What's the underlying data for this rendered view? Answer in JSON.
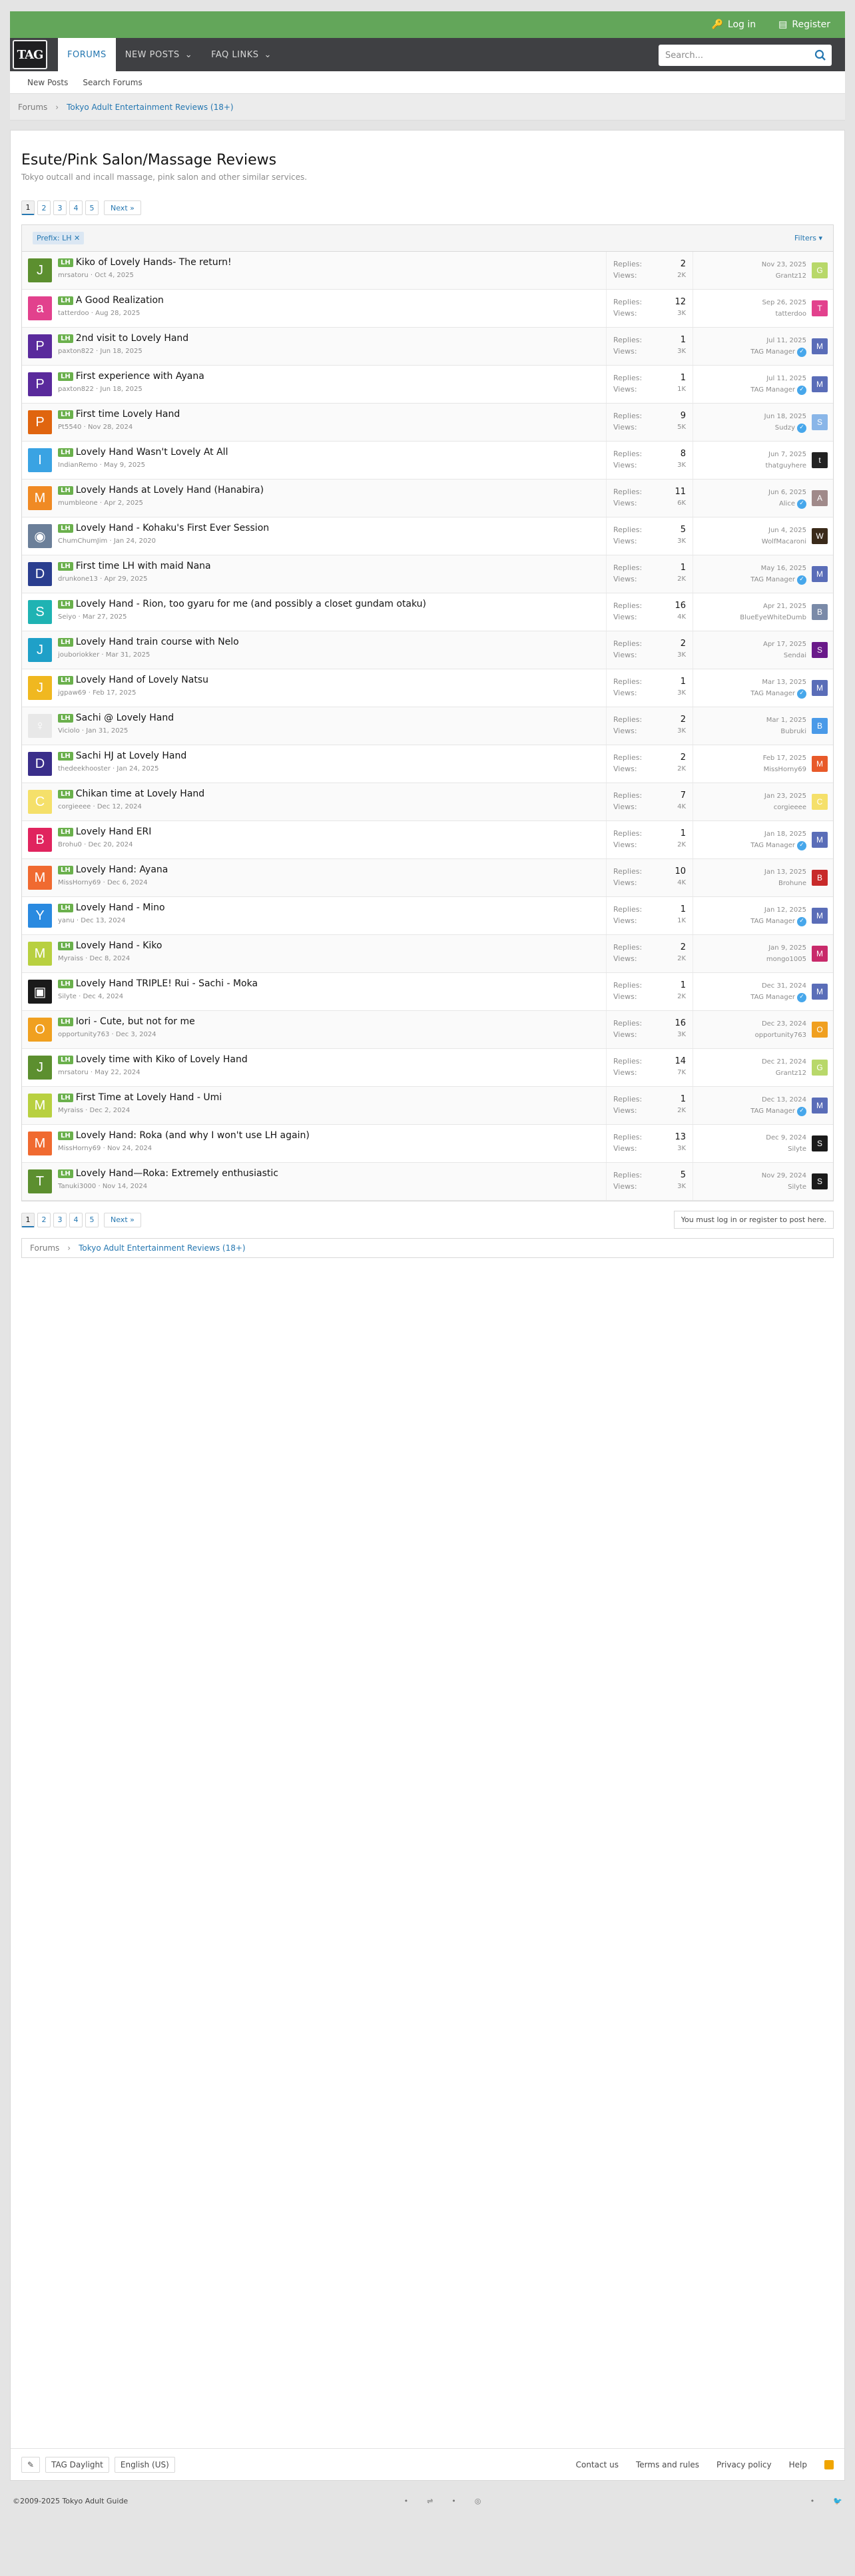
{
  "topbar": {
    "login": "Log in",
    "register": "Register"
  },
  "nav": {
    "logo": "TAG",
    "tabs": [
      {
        "label": "FORUMS"
      },
      {
        "label": "NEW POSTS"
      },
      {
        "label": "FAQ LINKS"
      }
    ],
    "search_placeholder": "Search..."
  },
  "subnav": {
    "items": [
      "New Posts",
      "Search Forums"
    ]
  },
  "breadcrumb": {
    "root": "Forums",
    "current": "Tokyo Adult Entertainment Reviews (18+)"
  },
  "page": {
    "title": "Esute/Pink Salon/Massage Reviews",
    "description": "Tokyo outcall and incall massage, pink salon and other similar services."
  },
  "pager": {
    "pages": [
      "1",
      "2",
      "3",
      "4",
      "5"
    ],
    "next": "Next »"
  },
  "filter": {
    "chip": "Prefix: LH ✕",
    "filters": "Filters ▾"
  },
  "labels": {
    "replies": "Replies:",
    "views": "Views:"
  },
  "threads": [
    {
      "letter": "J",
      "color": "#5c8f2f",
      "prefix": "LH",
      "title": "Kiko of Lovely Hands- The return!",
      "author": "mrsatoru",
      "date": "Oct 4, 2025",
      "replies": "2",
      "views": "2K",
      "last_date": "Nov 23, 2025",
      "last_user": "Grantz12",
      "last_letter": "G",
      "last_color": "#b8d86a",
      "verified": false
    },
    {
      "letter": "a",
      "color": "#e2418d",
      "prefix": "LH",
      "title": "A Good Realization",
      "author": "tatterdoo",
      "date": "Aug 28, 2025",
      "replies": "12",
      "views": "3K",
      "last_date": "Sep 26, 2025",
      "last_user": "tatterdoo",
      "last_letter": "T",
      "last_color": "#e2418d",
      "verified": false
    },
    {
      "letter": "P",
      "color": "#5a2a9c",
      "prefix": "LH",
      "title": "2nd visit to Lovely Hand",
      "author": "paxton822",
      "date": "Jun 18, 2025",
      "replies": "1",
      "views": "3K",
      "last_date": "Jul 11, 2025",
      "last_user": "TAG Manager",
      "last_letter": "M",
      "last_color": "#5a6db8",
      "verified": true
    },
    {
      "letter": "P",
      "color": "#5a2a9c",
      "prefix": "LH",
      "title": "First experience with Ayana",
      "author": "paxton822",
      "date": "Jun 18, 2025",
      "replies": "1",
      "views": "1K",
      "last_date": "Jul 11, 2025",
      "last_user": "TAG Manager",
      "last_letter": "M",
      "last_color": "#5a6db8",
      "verified": true
    },
    {
      "letter": "P",
      "color": "#e0650f",
      "prefix": "LH",
      "title": "First time Lovely Hand",
      "author": "Pt5540",
      "date": "Nov 28, 2024",
      "replies": "9",
      "views": "5K",
      "last_date": "Jun 18, 2025",
      "last_user": "Sudzy",
      "last_letter": "S",
      "last_color": "#8ab6e8",
      "verified": true
    },
    {
      "letter": "I",
      "color": "#3aa3e3",
      "prefix": "LH",
      "title": "Lovely Hand Wasn't Lovely At All",
      "author": "IndianRemo",
      "date": "May 9, 2025",
      "replies": "8",
      "views": "3K",
      "last_date": "Jun 7, 2025",
      "last_user": "thatguyhere",
      "last_letter": "t",
      "last_color": "#222222",
      "verified": false
    },
    {
      "letter": "M",
      "color": "#f08a24",
      "prefix": "LH",
      "title": "Lovely Hands at Lovely Hand (Hanabira)",
      "author": "mumbleone",
      "date": "Apr 2, 2025",
      "replies": "11",
      "views": "6K",
      "last_date": "Jun 6, 2025",
      "last_user": "Alice",
      "last_letter": "A",
      "last_color": "#a08a8a",
      "verified": true
    },
    {
      "letter": "◉",
      "color": "#6b7f99",
      "prefix": "LH",
      "title": "Lovely Hand - Kohaku's First Ever Session",
      "author": "ChumChumJim",
      "date": "Jan 24, 2020",
      "replies": "5",
      "views": "3K",
      "last_date": "Jun 4, 2025",
      "last_user": "WolfMacaroni",
      "last_letter": "W",
      "last_color": "#3a2a1a",
      "verified": false
    },
    {
      "letter": "D",
      "color": "#2a3e8f",
      "prefix": "LH",
      "title": "First time LH with maid Nana",
      "author": "drunkone13",
      "date": "Apr 29, 2025",
      "replies": "1",
      "views": "2K",
      "last_date": "May 16, 2025",
      "last_user": "TAG Manager",
      "last_letter": "M",
      "last_color": "#5a6db8",
      "verified": true
    },
    {
      "letter": "S",
      "color": "#1fb3b3",
      "prefix": "LH",
      "title": "Lovely Hand - Rion, too gyaru for me (and possibly a closet gundam otaku)",
      "author": "Seiyo",
      "date": "Mar 27, 2025",
      "replies": "16",
      "views": "4K",
      "last_date": "Apr 21, 2025",
      "last_user": "BlueEyeWhiteDumb",
      "last_letter": "B",
      "last_color": "#7a8aa8",
      "verified": false
    },
    {
      "letter": "J",
      "color": "#1fa0c8",
      "prefix": "LH",
      "title": "Lovely Hand train course with Nelo",
      "author": "jouboriokker",
      "date": "Mar 31, 2025",
      "replies": "2",
      "views": "3K",
      "last_date": "Apr 17, 2025",
      "last_user": "Sendai",
      "last_letter": "S",
      "last_color": "#6a1a8a",
      "verified": false
    },
    {
      "letter": "J",
      "color": "#f0b820",
      "prefix": "LH",
      "title": "Lovely Hand of Lovely Natsu",
      "author": "jgpaw69",
      "date": "Feb 17, 2025",
      "replies": "1",
      "views": "3K",
      "last_date": "Mar 13, 2025",
      "last_user": "TAG Manager",
      "last_letter": "M",
      "last_color": "#5a6db8",
      "verified": true
    },
    {
      "letter": "♀",
      "color": "#e8e8e8",
      "prefix": "LH",
      "title": "Sachi @ Lovely Hand",
      "author": "Viciolo",
      "date": "Jan 31, 2025",
      "replies": "2",
      "views": "3K",
      "last_date": "Mar 1, 2025",
      "last_user": "Bubruki",
      "last_letter": "B",
      "last_color": "#4a9ae8",
      "verified": false
    },
    {
      "letter": "D",
      "color": "#3a2e8a",
      "prefix": "LH",
      "title": "Sachi HJ at Lovely Hand",
      "author": "thedeekhooster",
      "date": "Jan 24, 2025",
      "replies": "2",
      "views": "2K",
      "last_date": "Feb 17, 2025",
      "last_user": "MissHorny69",
      "last_letter": "M",
      "last_color": "#e85a2a",
      "verified": false
    },
    {
      "letter": "C",
      "color": "#f5e06a",
      "prefix": "LH",
      "title": "Chikan time at Lovely Hand",
      "author": "corgieeee",
      "date": "Dec 12, 2024",
      "replies": "7",
      "views": "4K",
      "last_date": "Jan 23, 2025",
      "last_user": "corgieeee",
      "last_letter": "C",
      "last_color": "#f5e06a",
      "verified": false
    },
    {
      "letter": "B",
      "color": "#e0245e",
      "prefix": "LH",
      "title": "Lovely Hand ERI",
      "author": "Brohu0",
      "date": "Dec 20, 2024",
      "replies": "1",
      "views": "2K",
      "last_date": "Jan 18, 2025",
      "last_user": "TAG Manager",
      "last_letter": "M",
      "last_color": "#5a6db8",
      "verified": true
    },
    {
      "letter": "M",
      "color": "#f06a30",
      "prefix": "LH",
      "title": "Lovely Hand: Ayana",
      "author": "MissHorny69",
      "date": "Dec 6, 2024",
      "replies": "10",
      "views": "4K",
      "last_date": "Jan 13, 2025",
      "last_user": "Brohune",
      "last_letter": "B",
      "last_color": "#c82a2a",
      "verified": false
    },
    {
      "letter": "Y",
      "color": "#2a8ae0",
      "prefix": "LH",
      "title": "Lovely Hand - Mino",
      "author": "yanu",
      "date": "Dec 13, 2024",
      "replies": "1",
      "views": "1K",
      "last_date": "Jan 12, 2025",
      "last_user": "TAG Manager",
      "last_letter": "M",
      "last_color": "#5a6db8",
      "verified": true
    },
    {
      "letter": "M",
      "color": "#b8d040",
      "prefix": "LH",
      "title": "Lovely Hand - Kiko",
      "author": "Myraiss",
      "date": "Dec 8, 2024",
      "replies": "2",
      "views": "2K",
      "last_date": "Jan 9, 2025",
      "last_user": "mongo1005",
      "last_letter": "M",
      "last_color": "#c82a6a",
      "verified": false
    },
    {
      "letter": "▣",
      "color": "#1a1a1a",
      "prefix": "LH",
      "title": "Lovely Hand TRIPLE! Rui - Sachi - Moka",
      "author": "Silyte",
      "date": "Dec 4, 2024",
      "replies": "1",
      "views": "2K",
      "last_date": "Dec 31, 2024",
      "last_user": "TAG Manager",
      "last_letter": "M",
      "last_color": "#5a6db8",
      "verified": true
    },
    {
      "letter": "O",
      "color": "#f0a020",
      "prefix": "LH",
      "title": "Iori - Cute, but not for me",
      "author": "opportunity763",
      "date": "Dec 3, 2024",
      "replies": "16",
      "views": "3K",
      "last_date": "Dec 23, 2024",
      "last_user": "opportunity763",
      "last_letter": "O",
      "last_color": "#f0a020",
      "verified": false
    },
    {
      "letter": "J",
      "color": "#5c8f2f",
      "prefix": "LH",
      "title": "Lovely time with Kiko of Lovely Hand",
      "author": "mrsatoru",
      "date": "May 22, 2024",
      "replies": "14",
      "views": "7K",
      "last_date": "Dec 21, 2024",
      "last_user": "Grantz12",
      "last_letter": "G",
      "last_color": "#b8d86a",
      "verified": false
    },
    {
      "letter": "M",
      "color": "#b8d040",
      "prefix": "LH",
      "title": "First Time at Lovely Hand - Umi",
      "author": "Myraiss",
      "date": "Dec 2, 2024",
      "replies": "1",
      "views": "2K",
      "last_date": "Dec 13, 2024",
      "last_user": "TAG Manager",
      "last_letter": "M",
      "last_color": "#5a6db8",
      "verified": true
    },
    {
      "letter": "M",
      "color": "#f06a30",
      "prefix": "LH",
      "title": "Lovely Hand: Roka (and why I won't use LH again)",
      "author": "MissHorny69",
      "date": "Nov 24, 2024",
      "replies": "13",
      "views": "3K",
      "last_date": "Dec 9, 2024",
      "last_user": "Silyte",
      "last_letter": "S",
      "last_color": "#1a1a1a",
      "verified": false
    },
    {
      "letter": "T",
      "color": "#5c8f2f",
      "prefix": "LH",
      "title": "Lovely Hand—Roka: Extremely enthusiastic",
      "author": "Tanuki3000",
      "date": "Nov 14, 2024",
      "replies": "5",
      "views": "3K",
      "last_date": "Nov 29, 2024",
      "last_user": "Silyte",
      "last_letter": "S",
      "last_color": "#1a1a1a",
      "verified": false
    }
  ],
  "notice": "You must log in or register to post here.",
  "footer": {
    "style": "TAG Daylight",
    "language": "English (US)",
    "links": [
      "Contact us",
      "Terms and rules",
      "Privacy policy",
      "Help"
    ]
  },
  "copyright": "©2009-2025 Tokyo Adult Guide",
  "colors": {
    "green": "#63a65a",
    "nav": "#3f4043",
    "link": "#2577b1",
    "prefix": "#6ab04c"
  }
}
